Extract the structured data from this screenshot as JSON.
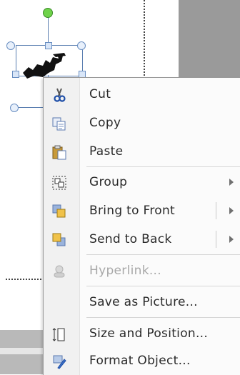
{
  "context_menu": {
    "items": [
      {
        "label": "Cut",
        "icon": "scissors-icon",
        "enabled": true
      },
      {
        "label": "Copy",
        "icon": "copy-icon",
        "enabled": true
      },
      {
        "label": "Paste",
        "icon": "paste-icon",
        "enabled": true
      },
      {
        "label": "Group",
        "icon": "group-icon",
        "enabled": true,
        "submenu": true
      },
      {
        "label": "Bring to Front",
        "icon": "bring-to-front-icon",
        "enabled": true,
        "submenu": true
      },
      {
        "label": "Send to Back",
        "icon": "send-to-back-icon",
        "enabled": true,
        "submenu": true
      },
      {
        "label": "Hyperlink...",
        "icon": "hyperlink-icon",
        "enabled": false
      },
      {
        "label": "Save as Picture...",
        "icon": "",
        "enabled": true
      },
      {
        "label": "Size and Position...",
        "icon": "size-position-icon",
        "enabled": true
      },
      {
        "label": "Format Object...",
        "icon": "format-object-icon",
        "enabled": true
      }
    ]
  },
  "colors": {
    "selection": "#5b7fb1",
    "rotation_handle": "#6fd24a",
    "menu_background": "#fbfbfb"
  }
}
